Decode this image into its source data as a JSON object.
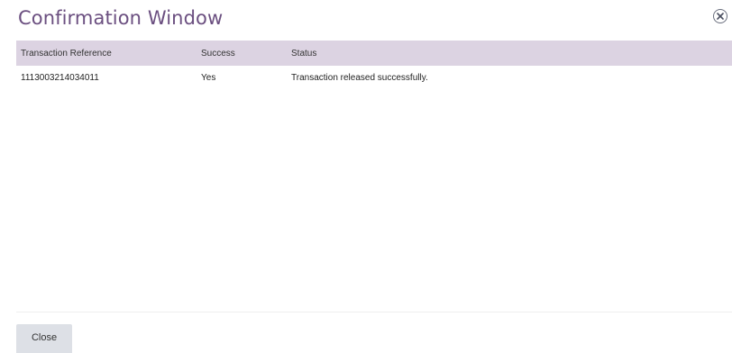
{
  "dialog": {
    "title": "Confirmation Window",
    "close_icon": "close-circle-icon"
  },
  "table": {
    "columns": [
      "Transaction Reference",
      "Success",
      "Status"
    ],
    "rows": [
      {
        "reference": "1113003214034011",
        "success": "Yes",
        "status": "Transaction released successfully."
      }
    ]
  },
  "footer": {
    "close_label": "Close"
  },
  "colors": {
    "title": "#6b4f80",
    "header_bg": "#dcd3e2",
    "button_bg": "#dde0e6"
  }
}
